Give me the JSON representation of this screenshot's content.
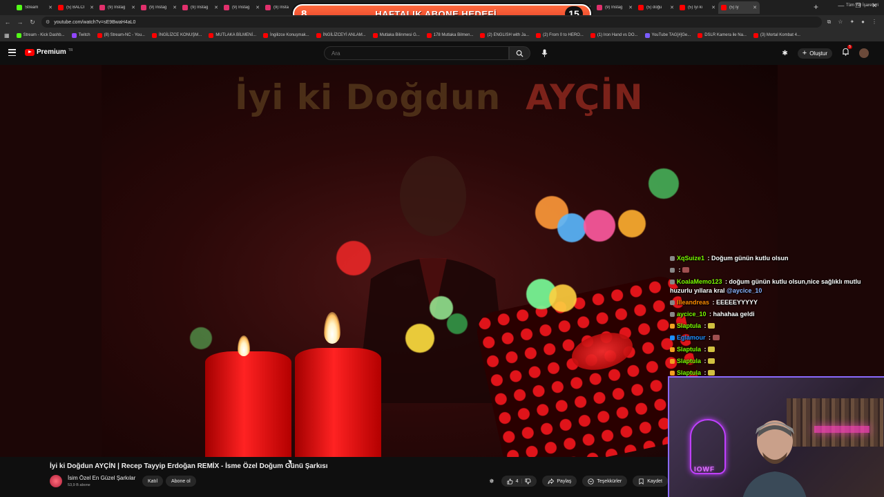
{
  "browser": {
    "tabs": [
      {
        "label": "Stream",
        "color": "#53fc18"
      },
      {
        "label": "(5) BALCI",
        "color": "#ff0000"
      },
      {
        "label": "(9) Instag",
        "color": "#e1306c"
      },
      {
        "label": "(9) Instag",
        "color": "#e1306c"
      },
      {
        "label": "(9) Instag",
        "color": "#e1306c"
      },
      {
        "label": "(9) Instag",
        "color": "#e1306c"
      },
      {
        "label": "(9) Insta",
        "color": "#e1306c"
      },
      {
        "label": "(9) Instag",
        "color": "#e1306c"
      },
      {
        "label": "(9) Instag",
        "color": "#e1306c"
      },
      {
        "label": "(9) Instag",
        "color": "#e1306c"
      },
      {
        "label": "(9) Instag",
        "color": "#e1306c"
      },
      {
        "label": "(9) Instag",
        "color": "#e1306c"
      },
      {
        "label": "(9) Instag",
        "color": "#e1306c"
      },
      {
        "label": "(9) Instag",
        "color": "#e1306c"
      },
      {
        "label": "(9) Instag",
        "color": "#e1306c"
      },
      {
        "label": "(5) doğu",
        "color": "#ff0000"
      },
      {
        "label": "(5) İyi ki",
        "color": "#ff0000"
      },
      {
        "label": "(5) İy",
        "color": "#ff0000",
        "active": true
      }
    ],
    "url": "youtube.com/watch?v=sE9BwaH4aL0",
    "bookmarks": [
      {
        "label": "Stream - Kick Dashb...",
        "color": "#53fc18"
      },
      {
        "label": "Twitch",
        "color": "#9146ff"
      },
      {
        "label": "(8) Stream-NC - You...",
        "color": "#ff0000"
      },
      {
        "label": "İNGİLİZCE KONUŞM...",
        "color": "#ff0000"
      },
      {
        "label": "MUTLAKA BİLMENİ...",
        "color": "#ff0000"
      },
      {
        "label": "İngilizce Konuşmak...",
        "color": "#ff0000"
      },
      {
        "label": "İNGİLİZCEYİ ANLAM...",
        "color": "#ff0000"
      },
      {
        "label": "Mutlaka Bilinmesi G...",
        "color": "#ff0000"
      },
      {
        "label": "178 Mutlaka Bilmen...",
        "color": "#ff0000"
      },
      {
        "label": "(2) ENGLISH with Ja...",
        "color": "#ff0000"
      },
      {
        "label": "(2) From 0 to HERO...",
        "color": "#ff0000"
      },
      {
        "label": "(1) Iron Hand vs DO...",
        "color": "#ff0000"
      },
      {
        "label": "YouTube TAG[#]Ge...",
        "color": "#7a5cff"
      },
      {
        "label": "DSLR Kamera ile Na...",
        "color": "#ff0000"
      },
      {
        "label": "(3) Mortal Kombat 4...",
        "color": "#ff0000"
      }
    ],
    "all_bookmarks_label": "Tüm Yer İşaretleri"
  },
  "goal_banner": {
    "left_number": "8",
    "text": "HAFTALIK ABONE HEDEFİ",
    "right_number": "15"
  },
  "youtube": {
    "brand": "Premium",
    "brand_sup": "TR",
    "search_placeholder": "Ara",
    "create_label": "Oluştur",
    "notification_count": "5"
  },
  "video": {
    "overlay_title_left": "İyi ki Doğdun",
    "overlay_title_right": "AYÇİN",
    "title": "İyi ki Doğdun AYÇİN | Recep Tayyip Erdoğan REMİX - İsme Özel Doğum Günü Şarkısı",
    "channel": "İsim Özel En Güzel Şarkılar",
    "subscribers": "53,9 B abone",
    "join_label": "Katıl",
    "subscribe_label": "Abone ol",
    "like_count": "4",
    "share_label": "Paylaş",
    "thanks_label": "Teşekkürler",
    "save_label": "Kaydet"
  },
  "chat": [
    {
      "user": "XqSuize1",
      "user_color": "#7cfc00",
      "text": "Doğum günün kutlu olsun",
      "badge": "#888888"
    },
    {
      "user": "",
      "user_color": "#ff69b4",
      "text": "",
      "badge": "#888888",
      "emote": "#a05050"
    },
    {
      "user": "KoalaMemo123",
      "user_color": "#7cfc00",
      "text": "doğum günün kutlu olsun,nice sağlıklı mutlu huzurlu yıllara kral",
      "mention": "@aycice_10",
      "badge": "#888888"
    },
    {
      "user": "Illeandreas",
      "user_color": "#ff8c00",
      "text": "EEEEEYYYYY",
      "badge": "#888888"
    },
    {
      "user": "aycice_10",
      "user_color": "#7cfc00",
      "text": "hahahaa geldi",
      "badge": "#888888"
    },
    {
      "user": "Slaptula",
      "user_color": "#7cfc00",
      "text": "",
      "badge": "#f0a020",
      "emote": "#d0c040"
    },
    {
      "user": "Eglamour",
      "user_color": "#1e90ff",
      "text": "",
      "badge": "#1e90ff",
      "emote": "#a05050"
    },
    {
      "user": "Slaptula",
      "user_color": "#7cfc00",
      "text": "",
      "badge": "#f0a020",
      "emote": "#d0c040"
    },
    {
      "user": "Slaptula",
      "user_color": "#7cfc00",
      "text": "",
      "badge": "#f0a020",
      "emote": "#d0c040"
    },
    {
      "user": "Slaptula",
      "user_color": "#7cfc00",
      "text": "",
      "badge": "#f0a020",
      "emote": "#d0c040"
    }
  ],
  "webcam": {
    "neon_text": "IOWF"
  }
}
